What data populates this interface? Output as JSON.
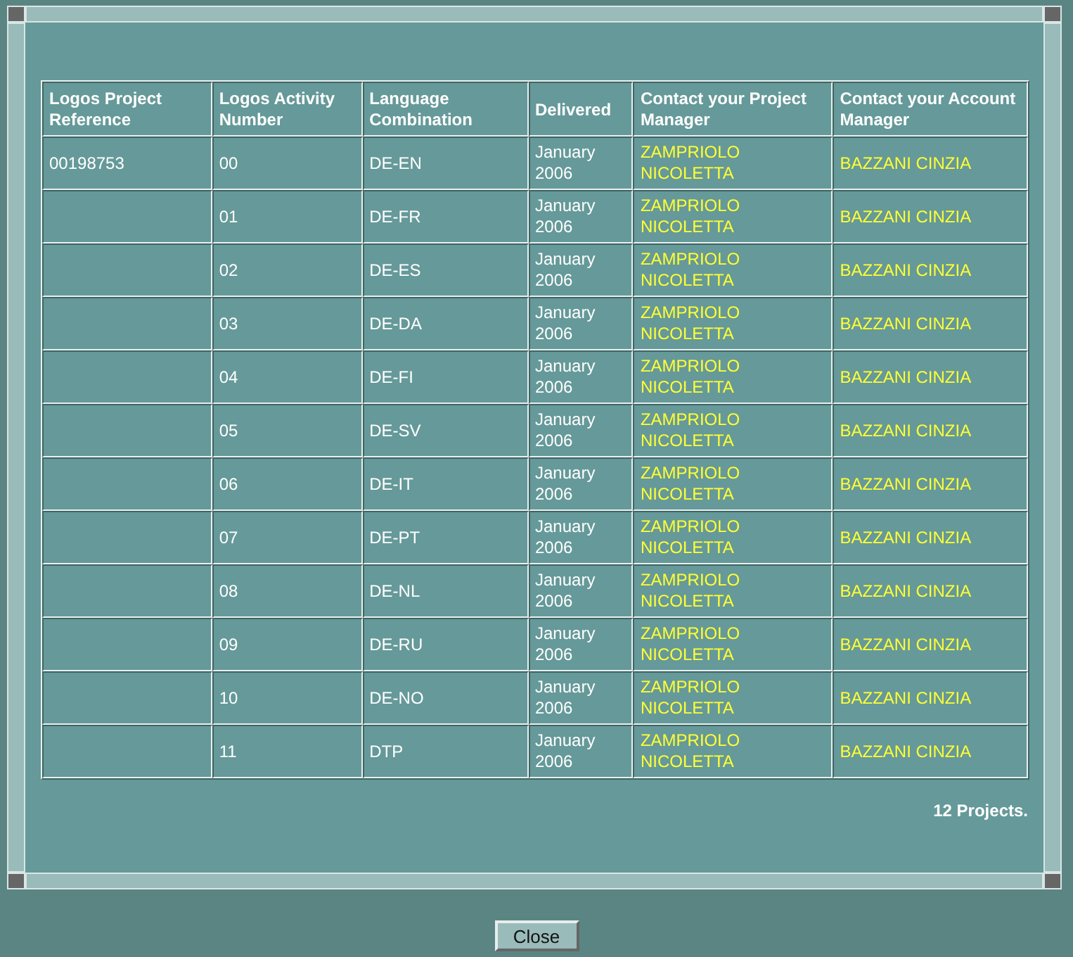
{
  "table": {
    "columns": [
      "Logos Project Reference",
      "Logos Activity Number",
      "Language Combination",
      "Delivered",
      "Contact your Project Manager",
      "Contact your Account Manager"
    ],
    "rows": [
      {
        "reference": "00198753",
        "activity": "00",
        "language": "DE-EN",
        "delivered": "January 2006",
        "project_manager": "ZAMPRIOLO NICOLETTA",
        "account_manager": "BAZZANI CINZIA"
      },
      {
        "activity": "01",
        "language": "DE-FR",
        "delivered": "January 2006",
        "project_manager": "ZAMPRIOLO NICOLETTA",
        "account_manager": "BAZZANI CINZIA"
      },
      {
        "activity": "02",
        "language": "DE-ES",
        "delivered": "January 2006",
        "project_manager": "ZAMPRIOLO NICOLETTA",
        "account_manager": "BAZZANI CINZIA"
      },
      {
        "activity": "03",
        "language": "DE-DA",
        "delivered": "January 2006",
        "project_manager": "ZAMPRIOLO NICOLETTA",
        "account_manager": "BAZZANI CINZIA"
      },
      {
        "activity": "04",
        "language": "DE-FI",
        "delivered": "January 2006",
        "project_manager": "ZAMPRIOLO NICOLETTA",
        "account_manager": "BAZZANI CINZIA"
      },
      {
        "activity": "05",
        "language": "DE-SV",
        "delivered": "January 2006",
        "project_manager": "ZAMPRIOLO NICOLETTA",
        "account_manager": "BAZZANI CINZIA"
      },
      {
        "activity": "06",
        "language": "DE-IT",
        "delivered": "January 2006",
        "project_manager": "ZAMPRIOLO NICOLETTA",
        "account_manager": "BAZZANI CINZIA"
      },
      {
        "activity": "07",
        "language": "DE-PT",
        "delivered": "January 2006",
        "project_manager": "ZAMPRIOLO NICOLETTA",
        "account_manager": "BAZZANI CINZIA"
      },
      {
        "activity": "08",
        "language": "DE-NL",
        "delivered": "January 2006",
        "project_manager": "ZAMPRIOLO NICOLETTA",
        "account_manager": "BAZZANI CINZIA"
      },
      {
        "activity": "09",
        "language": "DE-RU",
        "delivered": "January 2006",
        "project_manager": "ZAMPRIOLO NICOLETTA",
        "account_manager": "BAZZANI CINZIA"
      },
      {
        "activity": "10",
        "language": "DE-NO",
        "delivered": "January 2006",
        "project_manager": "ZAMPRIOLO NICOLETTA",
        "account_manager": "BAZZANI CINZIA"
      },
      {
        "activity": "11",
        "language": "DTP",
        "delivered": "January 2006",
        "project_manager": "ZAMPRIOLO NICOLETTA",
        "account_manager": "BAZZANI CINZIA"
      }
    ]
  },
  "summary": "12 Projects.",
  "buttons": [
    "Close"
  ]
}
